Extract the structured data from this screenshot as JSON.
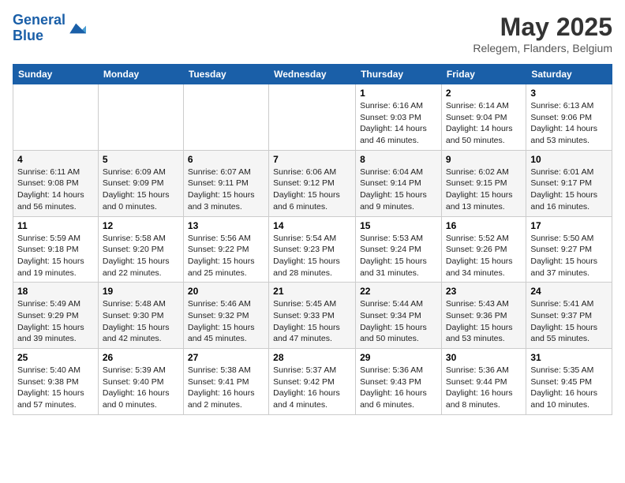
{
  "header": {
    "logo_line1": "General",
    "logo_line2": "Blue",
    "month": "May 2025",
    "location": "Relegem, Flanders, Belgium"
  },
  "days_of_week": [
    "Sunday",
    "Monday",
    "Tuesday",
    "Wednesday",
    "Thursday",
    "Friday",
    "Saturday"
  ],
  "weeks": [
    [
      {
        "day": "",
        "text": ""
      },
      {
        "day": "",
        "text": ""
      },
      {
        "day": "",
        "text": ""
      },
      {
        "day": "",
        "text": ""
      },
      {
        "day": "1",
        "text": "Sunrise: 6:16 AM\nSunset: 9:03 PM\nDaylight: 14 hours and 46 minutes."
      },
      {
        "day": "2",
        "text": "Sunrise: 6:14 AM\nSunset: 9:04 PM\nDaylight: 14 hours and 50 minutes."
      },
      {
        "day": "3",
        "text": "Sunrise: 6:13 AM\nSunset: 9:06 PM\nDaylight: 14 hours and 53 minutes."
      }
    ],
    [
      {
        "day": "4",
        "text": "Sunrise: 6:11 AM\nSunset: 9:08 PM\nDaylight: 14 hours and 56 minutes."
      },
      {
        "day": "5",
        "text": "Sunrise: 6:09 AM\nSunset: 9:09 PM\nDaylight: 15 hours and 0 minutes."
      },
      {
        "day": "6",
        "text": "Sunrise: 6:07 AM\nSunset: 9:11 PM\nDaylight: 15 hours and 3 minutes."
      },
      {
        "day": "7",
        "text": "Sunrise: 6:06 AM\nSunset: 9:12 PM\nDaylight: 15 hours and 6 minutes."
      },
      {
        "day": "8",
        "text": "Sunrise: 6:04 AM\nSunset: 9:14 PM\nDaylight: 15 hours and 9 minutes."
      },
      {
        "day": "9",
        "text": "Sunrise: 6:02 AM\nSunset: 9:15 PM\nDaylight: 15 hours and 13 minutes."
      },
      {
        "day": "10",
        "text": "Sunrise: 6:01 AM\nSunset: 9:17 PM\nDaylight: 15 hours and 16 minutes."
      }
    ],
    [
      {
        "day": "11",
        "text": "Sunrise: 5:59 AM\nSunset: 9:18 PM\nDaylight: 15 hours and 19 minutes."
      },
      {
        "day": "12",
        "text": "Sunrise: 5:58 AM\nSunset: 9:20 PM\nDaylight: 15 hours and 22 minutes."
      },
      {
        "day": "13",
        "text": "Sunrise: 5:56 AM\nSunset: 9:22 PM\nDaylight: 15 hours and 25 minutes."
      },
      {
        "day": "14",
        "text": "Sunrise: 5:54 AM\nSunset: 9:23 PM\nDaylight: 15 hours and 28 minutes."
      },
      {
        "day": "15",
        "text": "Sunrise: 5:53 AM\nSunset: 9:24 PM\nDaylight: 15 hours and 31 minutes."
      },
      {
        "day": "16",
        "text": "Sunrise: 5:52 AM\nSunset: 9:26 PM\nDaylight: 15 hours and 34 minutes."
      },
      {
        "day": "17",
        "text": "Sunrise: 5:50 AM\nSunset: 9:27 PM\nDaylight: 15 hours and 37 minutes."
      }
    ],
    [
      {
        "day": "18",
        "text": "Sunrise: 5:49 AM\nSunset: 9:29 PM\nDaylight: 15 hours and 39 minutes."
      },
      {
        "day": "19",
        "text": "Sunrise: 5:48 AM\nSunset: 9:30 PM\nDaylight: 15 hours and 42 minutes."
      },
      {
        "day": "20",
        "text": "Sunrise: 5:46 AM\nSunset: 9:32 PM\nDaylight: 15 hours and 45 minutes."
      },
      {
        "day": "21",
        "text": "Sunrise: 5:45 AM\nSunset: 9:33 PM\nDaylight: 15 hours and 47 minutes."
      },
      {
        "day": "22",
        "text": "Sunrise: 5:44 AM\nSunset: 9:34 PM\nDaylight: 15 hours and 50 minutes."
      },
      {
        "day": "23",
        "text": "Sunrise: 5:43 AM\nSunset: 9:36 PM\nDaylight: 15 hours and 53 minutes."
      },
      {
        "day": "24",
        "text": "Sunrise: 5:41 AM\nSunset: 9:37 PM\nDaylight: 15 hours and 55 minutes."
      }
    ],
    [
      {
        "day": "25",
        "text": "Sunrise: 5:40 AM\nSunset: 9:38 PM\nDaylight: 15 hours and 57 minutes."
      },
      {
        "day": "26",
        "text": "Sunrise: 5:39 AM\nSunset: 9:40 PM\nDaylight: 16 hours and 0 minutes."
      },
      {
        "day": "27",
        "text": "Sunrise: 5:38 AM\nSunset: 9:41 PM\nDaylight: 16 hours and 2 minutes."
      },
      {
        "day": "28",
        "text": "Sunrise: 5:37 AM\nSunset: 9:42 PM\nDaylight: 16 hours and 4 minutes."
      },
      {
        "day": "29",
        "text": "Sunrise: 5:36 AM\nSunset: 9:43 PM\nDaylight: 16 hours and 6 minutes."
      },
      {
        "day": "30",
        "text": "Sunrise: 5:36 AM\nSunset: 9:44 PM\nDaylight: 16 hours and 8 minutes."
      },
      {
        "day": "31",
        "text": "Sunrise: 5:35 AM\nSunset: 9:45 PM\nDaylight: 16 hours and 10 minutes."
      }
    ]
  ]
}
